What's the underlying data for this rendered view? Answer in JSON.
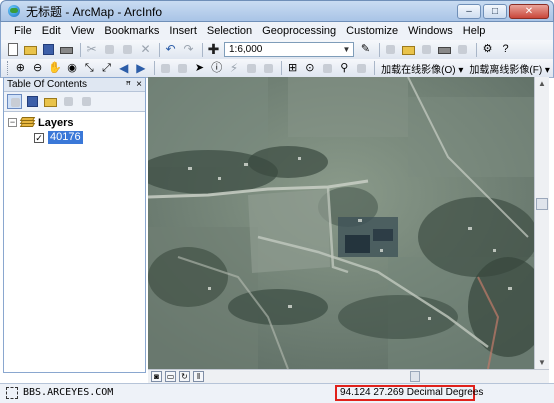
{
  "window": {
    "title": "无标题 - ArcMap - ArcInfo",
    "minimize_glyph": "–",
    "maximize_glyph": "□",
    "close_glyph": "✕"
  },
  "menu": {
    "items": [
      "File",
      "Edit",
      "View",
      "Bookmarks",
      "Insert",
      "Selection",
      "Geoprocessing",
      "Customize",
      "Windows",
      "Help"
    ]
  },
  "toolbar": {
    "scale_value": "1:6,000",
    "online_imagery_label": "加载在线影像(O) ▾",
    "offline_imagery_label": "加载离线影像(F) ▾"
  },
  "toc": {
    "title": "Table Of Contents",
    "pin_glyph": "ꟸ",
    "close_glyph": "×",
    "root_label": "Layers",
    "layer_name": "40176",
    "layer_checked": true
  },
  "status": {
    "watermark": "BBS.ARCEYES.COM",
    "coordinates": "94.124  27.269 Decimal Degrees"
  },
  "colors": {
    "highlight_border": "#e0211b",
    "selected_layer": "#3a78d8"
  }
}
